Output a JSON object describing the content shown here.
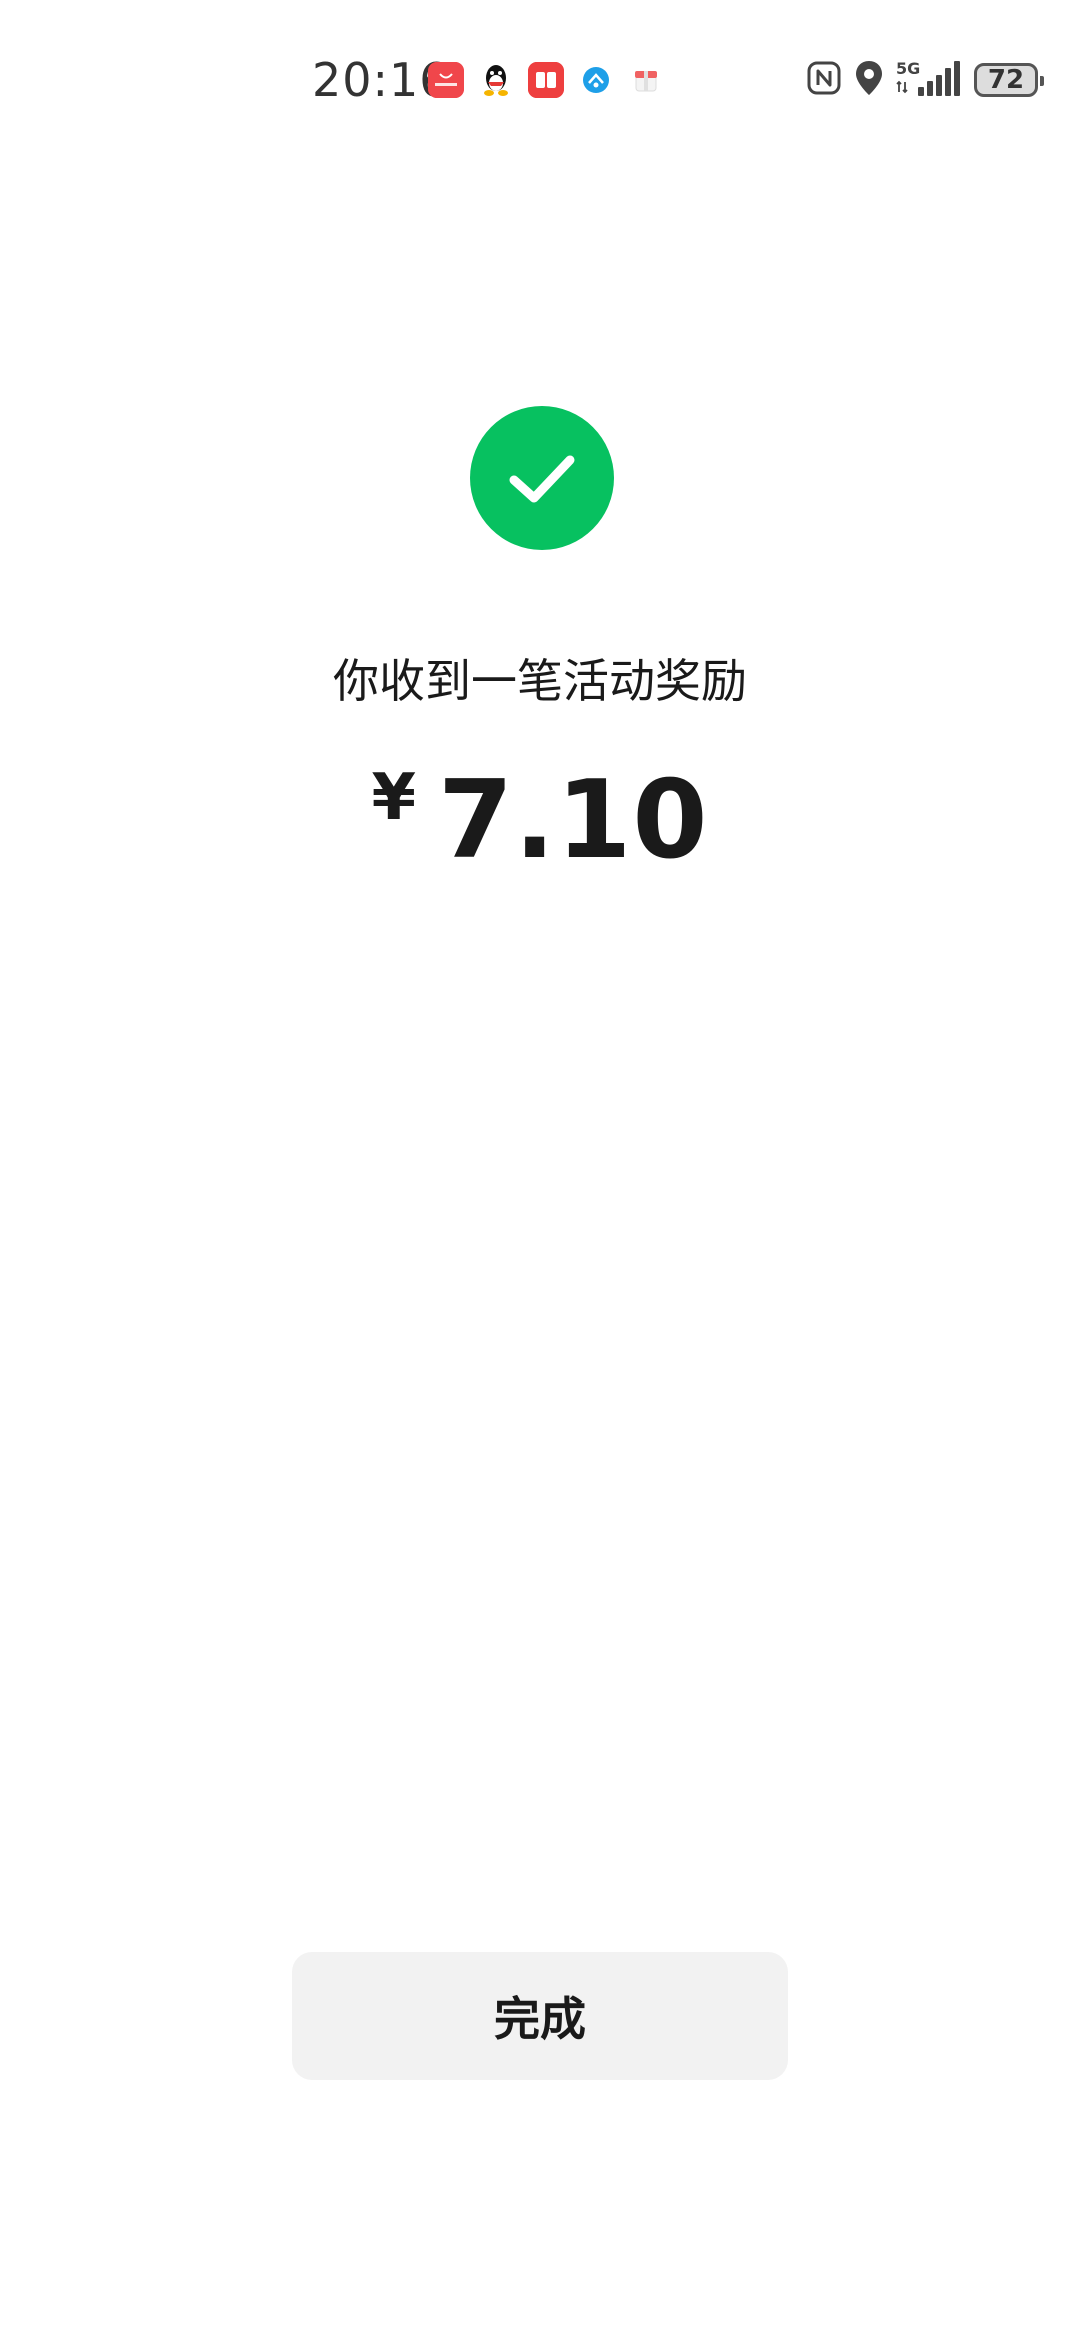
{
  "status_bar": {
    "time": "20:16",
    "notification_icons": [
      "huawei-appgallery-icon",
      "qq-icon",
      "red-book-icon",
      "blue-app-icon",
      "gift-box-icon"
    ],
    "system_icons": [
      "nfc-icon",
      "location-icon",
      "5g-signal-icon"
    ],
    "network": "5G",
    "battery_level": "72"
  },
  "result": {
    "icon": "success-check-icon",
    "message": "你收到一笔活动奖励",
    "currency_symbol": "¥",
    "amount": "7.10"
  },
  "actions": {
    "done_label": "完成"
  },
  "colors": {
    "success": "#07c160",
    "button_bg": "#f2f2f2",
    "text": "#1a1a1a"
  }
}
